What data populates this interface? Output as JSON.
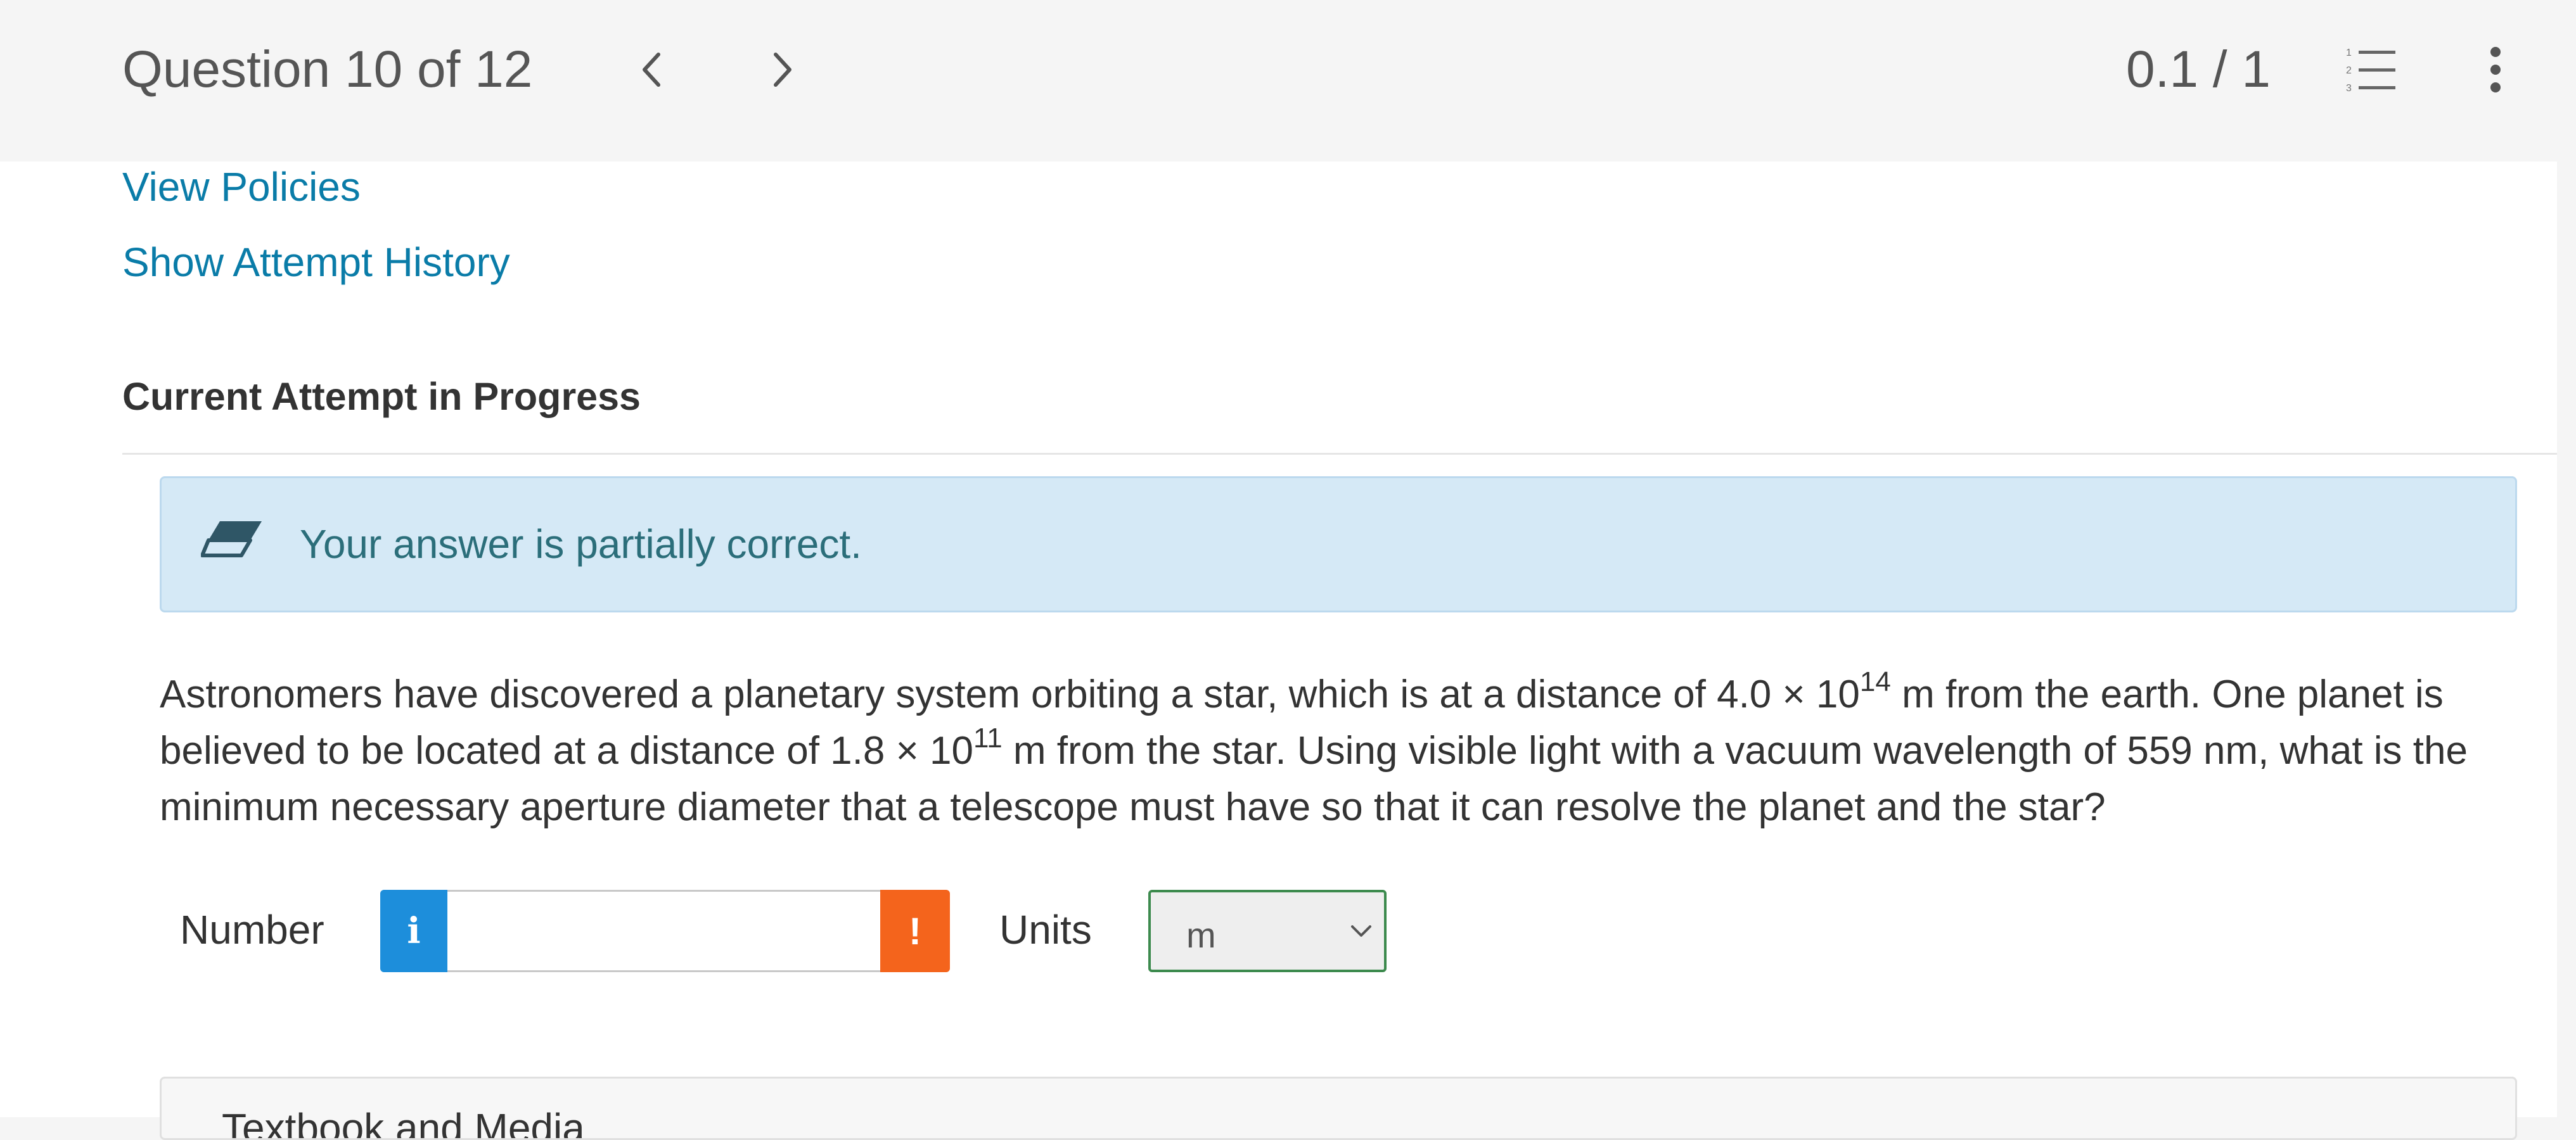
{
  "header": {
    "question_label": "Question 10 of 12",
    "prev_icon": "chevron-left-icon",
    "next_icon": "chevron-right-icon",
    "score": "0.1 / 1",
    "list_icon": "numbered-list-icon",
    "more_icon": "more-vertical-icon"
  },
  "links": {
    "policies": "View Policies",
    "history": "Show Attempt History"
  },
  "attempt": {
    "heading": "Current Attempt in Progress"
  },
  "feedback": {
    "icon": "eraser-icon",
    "text": "Your answer is partially correct.",
    "background": "#d5e9f6"
  },
  "question": {
    "p1": "Astronomers have discovered a planetary system orbiting a star, which is at a distance of 4.0 × 10",
    "exp1": "14",
    "p2": " m from the earth. One planet is believed to be located at a distance of 1.8 × 10",
    "exp2": "11",
    "p3": " m from the star. Using visible light with a vacuum wavelength of 559 nm, what is the minimum necessary aperture diameter that a telescope must have so that it can resolve the planet and the star?"
  },
  "answer": {
    "number_label": "Number",
    "info_glyph": "i",
    "number_value": "",
    "warn_glyph": "!",
    "units_label": "Units",
    "units_value": "m"
  },
  "media": {
    "title": "Textbook and Media"
  },
  "colors": {
    "link": "#0a7ca8",
    "info_button": "#1d8edb",
    "warning_button": "#f4641c",
    "select_border": "#3c8a4d"
  }
}
